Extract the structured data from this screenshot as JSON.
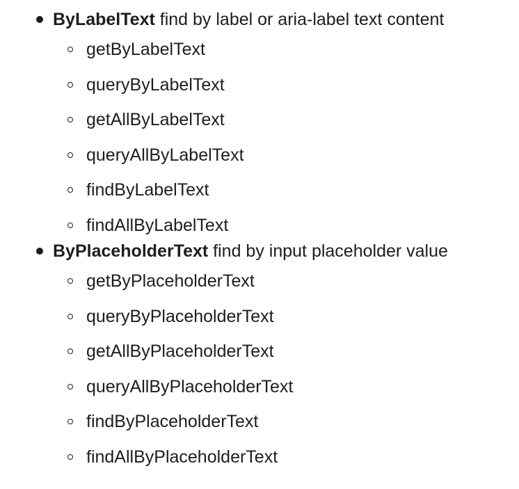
{
  "sections": [
    {
      "term": "ByLabelText",
      "description": " find by label or aria-label text content",
      "queries": [
        "getByLabelText",
        "queryByLabelText",
        "getAllByLabelText",
        "queryAllByLabelText",
        "findByLabelText",
        "findAllByLabelText"
      ]
    },
    {
      "term": "ByPlaceholderText",
      "description": " find by input placeholder value",
      "queries": [
        "getByPlaceholderText",
        "queryByPlaceholderText",
        "getAllByPlaceholderText",
        "queryAllByPlaceholderText",
        "findByPlaceholderText",
        "findAllByPlaceholderText"
      ]
    }
  ]
}
